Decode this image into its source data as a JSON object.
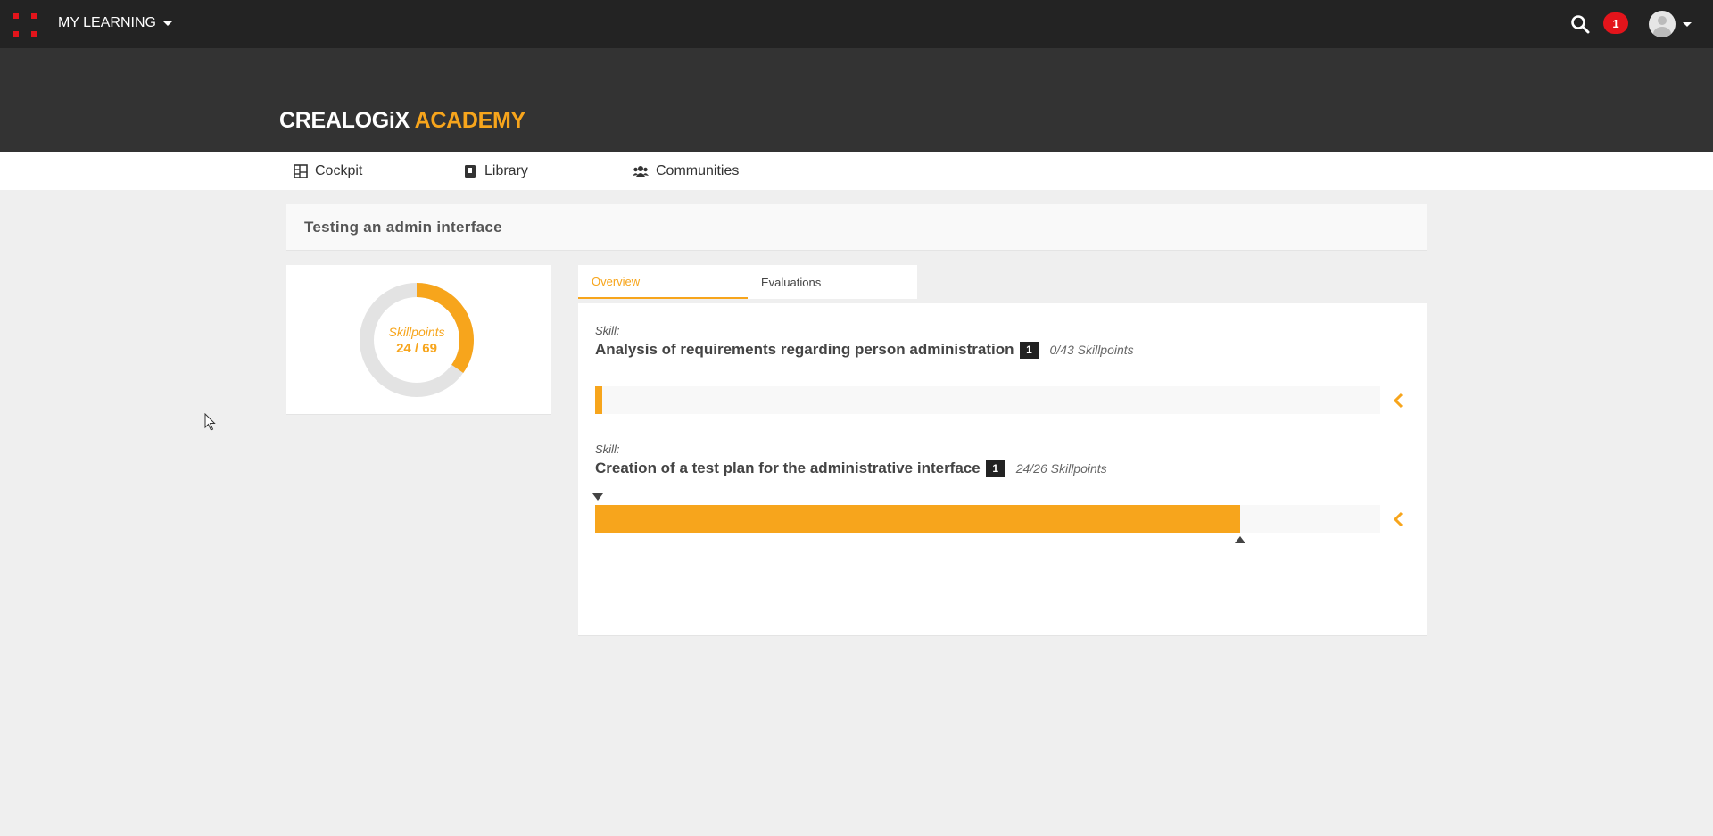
{
  "topbar": {
    "app_menu_label": "MY LEARNING",
    "notification_count": "1"
  },
  "brand": {
    "logo_part1": "CREALOGiX",
    "logo_part2": "ACADEMY",
    "accent_color": "#f7a51c"
  },
  "subnav": {
    "items": [
      {
        "label": "Cockpit",
        "icon": "dashboard-icon"
      },
      {
        "label": "Library",
        "icon": "book-icon"
      },
      {
        "label": "Communities",
        "icon": "users-icon"
      }
    ]
  },
  "course": {
    "title": "Testing an admin interface"
  },
  "summary": {
    "label": "Skillpoints",
    "value_text": "24 / 69",
    "earned": 24,
    "total": 69
  },
  "tabs": [
    {
      "label": "Overview",
      "active": true
    },
    {
      "label": "Evaluations",
      "active": false
    }
  ],
  "skills": [
    {
      "kicker": "Skill:",
      "name": "Analysis of requirements regarding person administration",
      "level": "1",
      "points_text": "0/43 Skillpoints",
      "earned": 0,
      "total": 43
    },
    {
      "kicker": "Skill:",
      "name": "Creation of a test plan for the administrative interface",
      "level": "1",
      "points_text": "24/26 Skillpoints",
      "earned": 24,
      "total": 26
    }
  ]
}
